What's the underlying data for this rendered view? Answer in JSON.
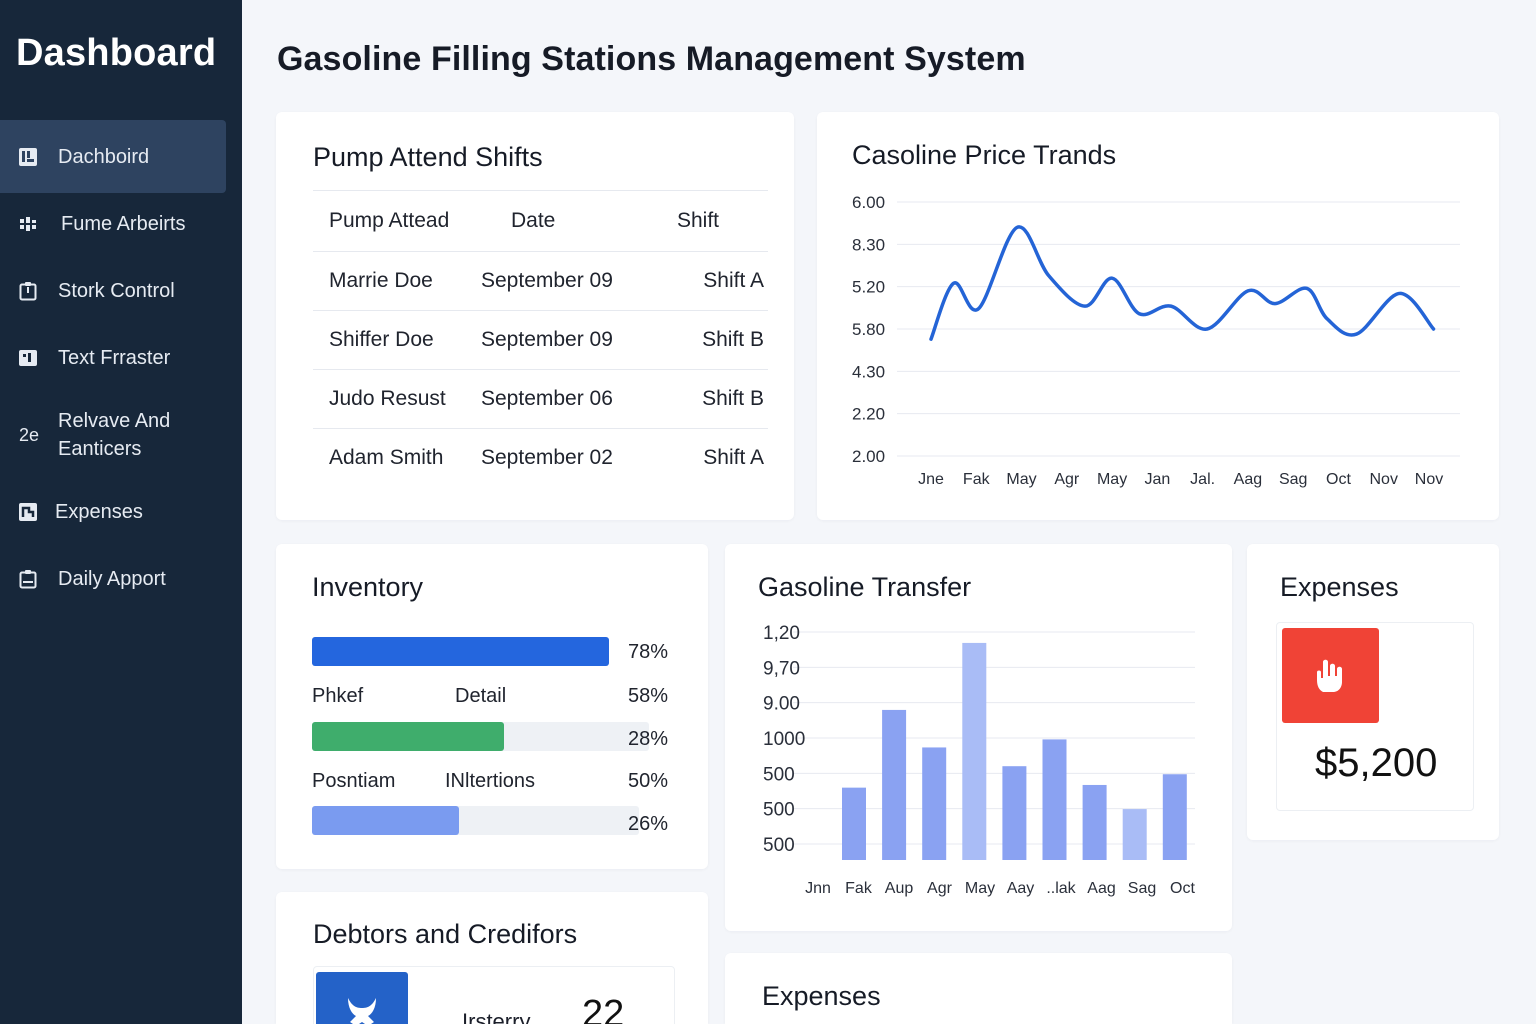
{
  "sidebar": {
    "brand": "Dashboard",
    "items": [
      {
        "label": "Dachboird",
        "icon": "dashboard-icon",
        "active": true
      },
      {
        "label": "Fume Arbeirts",
        "icon": "pump-icon"
      },
      {
        "label": "Stork Control",
        "icon": "clipboard-icon"
      },
      {
        "label": "Text Frraster",
        "icon": "transfer-icon"
      },
      {
        "label": "Relvave And Eanticers",
        "icon": "receivables-icon",
        "icon_text": "2e"
      },
      {
        "label": "Expenses",
        "icon": "expenses-icon"
      },
      {
        "label": "Daily Apport",
        "icon": "report-icon"
      }
    ]
  },
  "header": {
    "title": "Gasoline Filling Stations Management System"
  },
  "pump_shifts": {
    "title": "Pump Attend Shifts",
    "columns": [
      "Pump Attead",
      "Date",
      "Shift"
    ],
    "rows": [
      [
        "Marrie Doe",
        "September 09",
        "Shift A"
      ],
      [
        "Shiffer Doe",
        "September 09",
        "Shift B"
      ],
      [
        "Judo Resust",
        "September 06",
        "Shift B"
      ],
      [
        "Adam Smith",
        "September 02",
        "Shift A"
      ]
    ]
  },
  "price_trends": {
    "title": "Casoline Price Trands",
    "chart_data": {
      "type": "line",
      "y_tick_labels": [
        "6.00",
        "8.30",
        "5.20",
        "5.80",
        "4.30",
        "2.20",
        "2.00"
      ],
      "x_tick_labels": [
        "Jne",
        "Fak",
        "May",
        "Agr",
        "May",
        "Jan",
        "Jal.",
        "Aag",
        "Sag",
        "Oct",
        "Nov",
        "Nov"
      ],
      "grid": true,
      "series": [
        {
          "color": "#2464d6",
          "x": [
            0,
            0.5,
            1.05,
            1.9,
            2.6,
            3.4,
            4.0,
            4.6,
            5.3,
            6.1,
            7.0,
            7.6,
            8.3,
            8.75,
            9.4,
            10.35,
            11.1
          ],
          "y": [
            4.3,
            5.4,
            4.9,
            6.5,
            5.55,
            4.95,
            5.5,
            4.8,
            4.95,
            4.5,
            5.25,
            5.0,
            5.3,
            4.7,
            4.4,
            5.2,
            4.5
          ]
        }
      ]
    }
  },
  "inventory": {
    "title": "Inventory",
    "items": [
      {
        "label": "",
        "label2": "",
        "pct_text": "78%",
        "fill": 1.0,
        "color": "#2466de"
      },
      {
        "label": "Phkef",
        "label2": "Detail",
        "pct_text": "58%"
      },
      {
        "label": "",
        "label2": "",
        "pct_text": "28%",
        "fill": 0.57,
        "color": "#3fad6c"
      },
      {
        "label": "Posntiam",
        "label2": "INltertions",
        "pct_text": "50%"
      },
      {
        "label": "",
        "label2": "",
        "pct_text": "26%",
        "fill": 0.45,
        "color": "#7a9bf0"
      }
    ]
  },
  "transfer": {
    "title": "Gasoline Transfer",
    "chart_data": {
      "type": "bar",
      "y_tick_labels": [
        "1,20",
        "9,70",
        "9.00",
        "1000",
        "500",
        "500",
        "500"
      ],
      "categories": [
        "Jnn",
        "Fak",
        "Aup",
        "Agr",
        "May",
        "Aay",
        "..lak",
        "Aag",
        "Sag",
        "Oct"
      ],
      "values": [
        0.27,
        0.56,
        0.42,
        0.81,
        0.35,
        0.45,
        0.28,
        0.19,
        0.32
      ],
      "value_scale": "fraction of plotted range (axis labels are inconsistent)",
      "bar_colors": [
        "#8aa2f2",
        "#8aa2f2",
        "#8aa2f2",
        "#a9bcf6",
        "#8aa2f2",
        "#8aa2f2",
        "#8aa2f2",
        "#a9bcf6",
        "#8aa2f2"
      ],
      "grid": true
    }
  },
  "expenses_card": {
    "title": "Expenses",
    "value": "$5,200",
    "icon": "hand-icon",
    "icon_color": "#f04336"
  },
  "debtors": {
    "title": "Debtors and Credifors",
    "label": "Irsterry",
    "value": "22",
    "icon": "shield-icon",
    "icon_color": "#2462c8"
  },
  "expenses_bottom": {
    "title": "Expenses"
  }
}
